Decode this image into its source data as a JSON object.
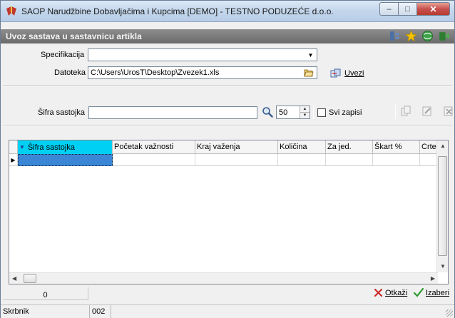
{
  "window": {
    "title": "SAOP  Narudžbine Dobavljačima i Kupcima [DEMO] - TESTNO PODUZEĆE d.o.o.",
    "buttons": {
      "minimize": "–",
      "maximize": "□",
      "close": "✕"
    }
  },
  "header": {
    "title": "Uvoz sastava u sastavnicu artikla",
    "icons": [
      "hierarchy-icon",
      "star-icon",
      "globe-icon",
      "exit-icon"
    ]
  },
  "form": {
    "specifikacija_label": "Specifikacija",
    "specifikacija_value": "",
    "datoteka_label": "Datoteka",
    "datoteka_value": "C:\\Users\\UrosT\\Desktop\\Zvezek1.xls",
    "uvezi_label": "Uvezi"
  },
  "filter": {
    "sifra_label": "Šifra sastojka",
    "sifra_value": "",
    "page_size": "50",
    "svi_zapisi_label": "Svi zapisi",
    "svi_zapisi_checked": false
  },
  "grid": {
    "columns": [
      "Šifra sastojka",
      "Početak važnosti",
      "Kraj važenja",
      "Količina",
      "Za jed.",
      "Škart %",
      "Crte:"
    ],
    "rows": [
      [
        "",
        "",
        "",
        "",
        "",
        "",
        ""
      ]
    ]
  },
  "footer": {
    "count": "0",
    "cancel_label": "Otkaži",
    "select_label": "Izaberi"
  },
  "status": {
    "user": "Skrbnik",
    "code": "002"
  },
  "colors": {
    "header_bg": "#7a7a7a",
    "active_column": "#00d0f4",
    "cancel_icon": "#cc2222",
    "select_icon": "#2e9a2e"
  }
}
